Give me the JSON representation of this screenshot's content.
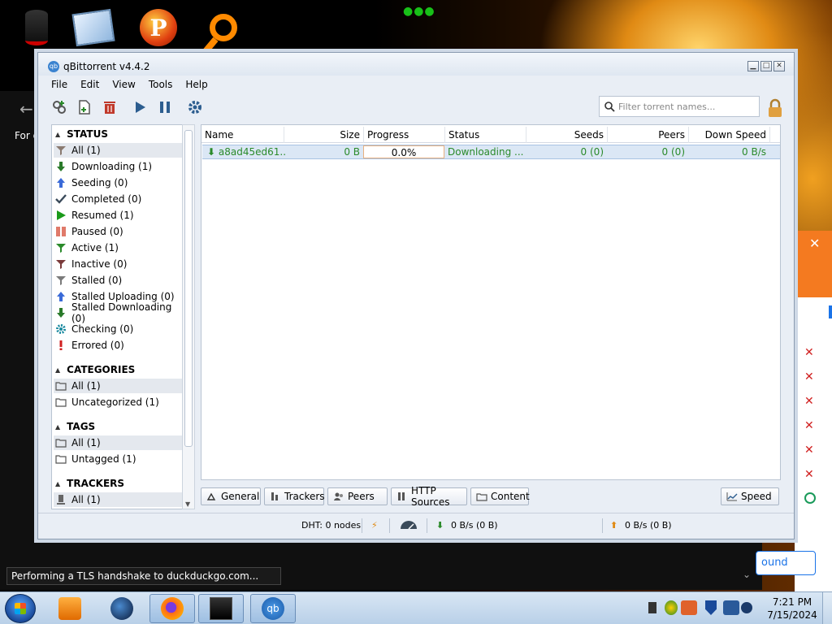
{
  "desktop": {
    "icons": [
      "cylinder-app-icon",
      "mail-app-icon",
      "p-app-icon",
      "search-app-icon"
    ],
    "p_letter": "P"
  },
  "browser": {
    "back_glyph": "←",
    "for_text": "For q",
    "status_text": "Performing a TLS handshake to duckduckgo.com...",
    "found_text": "ound"
  },
  "qb": {
    "title": "qBittorrent v4.4.2",
    "icon_letters": "qb",
    "menu": [
      "File",
      "Edit",
      "View",
      "Tools",
      "Help"
    ],
    "search_placeholder": "Filter torrent names...",
    "sidebar": {
      "status_header": "STATUS",
      "status_items": [
        {
          "label": "All (1)",
          "icon": "filter-icon"
        },
        {
          "label": "Downloading (1)",
          "icon": "down-arrow-icon"
        },
        {
          "label": "Seeding (0)",
          "icon": "up-arrow-icon"
        },
        {
          "label": "Completed (0)",
          "icon": "check-icon"
        },
        {
          "label": "Resumed (1)",
          "icon": "play-icon"
        },
        {
          "label": "Paused (0)",
          "icon": "pause-icon"
        },
        {
          "label": "Active (1)",
          "icon": "filter-icon"
        },
        {
          "label": "Inactive (0)",
          "icon": "filter-icon"
        },
        {
          "label": "Stalled (0)",
          "icon": "filter-icon"
        },
        {
          "label": "Stalled Uploading (0)",
          "icon": "up-arrow-icon"
        },
        {
          "label": "Stalled Downloading (0)",
          "icon": "down-arrow-icon"
        },
        {
          "label": "Checking (0)",
          "icon": "gear-icon"
        },
        {
          "label": "Errored (0)",
          "icon": "exclamation-icon"
        }
      ],
      "categories_header": "CATEGORIES",
      "categories_items": [
        "All (1)",
        "Uncategorized (1)"
      ],
      "tags_header": "TAGS",
      "tags_items": [
        "All (1)",
        "Untagged (1)"
      ],
      "trackers_header": "TRACKERS",
      "trackers_items": [
        "All (1)"
      ]
    },
    "table": {
      "columns": [
        "Name",
        "Size",
        "Progress",
        "Status",
        "Seeds",
        "Peers",
        "Down Speed"
      ],
      "rows": [
        {
          "name": "a8ad45ed61...",
          "size": "0 B",
          "progress": "0.0%",
          "status": "Downloading ...",
          "seeds": "0 (0)",
          "peers": "0 (0)",
          "down_speed": "0 B/s"
        }
      ]
    },
    "tabs": [
      "General",
      "Trackers",
      "Peers",
      "HTTP Sources",
      "Content"
    ],
    "speed_button": "Speed",
    "statusbar": {
      "dht": "DHT: 0 nodes",
      "down": "0 B/s (0 B)",
      "up": "0 B/s (0 B)"
    }
  },
  "taskbar": {
    "time": "7:21 PM",
    "date": "7/15/2024",
    "qb_letters": "qb"
  },
  "colors": {
    "accent_orange": "#f47a20",
    "downloading_green": "#2a8a2a",
    "row_highlight": "#dbe7f5"
  }
}
